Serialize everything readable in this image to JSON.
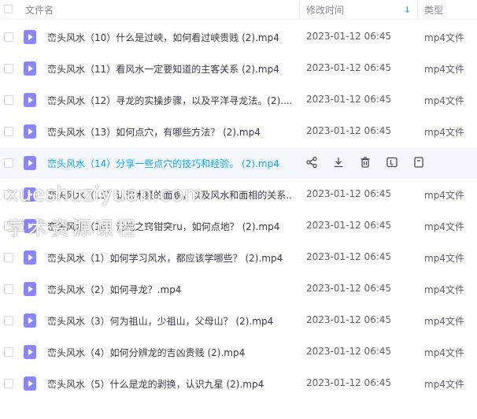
{
  "header": {
    "name_label": "文件名",
    "modified_label": "修改时间",
    "sort_icon": "arrow-down-icon",
    "type_label": "类型"
  },
  "rows": [
    {
      "name": "峦头风水（10）什么是过峡，如何看过峡贵贱 (2).mp4",
      "date": "2023-01-12 06:45",
      "type": "mp4文件"
    },
    {
      "name": "峦头风水（11）看风水一定要知道的主客关系 (2).mp4",
      "date": "2023-01-12 06:45",
      "type": "mp4文件"
    },
    {
      "name": "峦头风水（12）寻龙的实操步骤，以及平洋寻龙法。(2)....",
      "date": "2023-01-12 06:45",
      "type": "mp4文件"
    },
    {
      "name": "峦头风水（13）如何点穴，有哪些方法？ (2).mp4",
      "date": "2023-01-12 06:45",
      "type": "mp4文件"
    },
    {
      "name": "峦头风水（14）分享一些点穴的技巧和经验。 (2).mp4",
      "date": "",
      "type": ""
    },
    {
      "name": "峦头风水（15）认识木星的面貌，以及风水和面相的关系...",
      "date": "2023-01-12 06:45",
      "type": "mp4文件"
    },
    {
      "name": "峦头风水（16）论地之窍钳突ru，如何点地？ (2).mp4",
      "date": "2023-01-12 06:45",
      "type": "mp4文件"
    },
    {
      "name": "峦头风水（1）如何学习风水，都应该学哪些？ (2).mp4",
      "date": "2023-01-12 06:45",
      "type": "mp4文件"
    },
    {
      "name": "峦头风水（2）如何寻龙？.mp4",
      "date": "2023-01-12 06:45",
      "type": "mp4文件"
    },
    {
      "name": "峦头风水（3）何为祖山，少祖山，父母山？ (2).mp4",
      "date": "2023-01-12 06:45",
      "type": "mp4文件"
    },
    {
      "name": "峦头风水（4）如何分辨龙的吉凶贵贱 (2).mp4",
      "date": "2023-01-12 06:45",
      "type": "mp4文件"
    },
    {
      "name": "峦头风水（5）什么是龙的剥换，认识九星 (2).mp4",
      "date": "2023-01-12 06:45",
      "type": "mp4文件"
    }
  ],
  "hover_actions": [
    "share-icon",
    "download-icon",
    "delete-icon",
    "rename-icon",
    "more-icon"
  ],
  "watermark": {
    "line1": "xueshuziyuan.com",
    "line2": "学术资源课程"
  },
  "colors": {
    "accent": "#06a7ff",
    "video_icon": "#8a86f8",
    "hover_row": "#f5f9ff"
  }
}
